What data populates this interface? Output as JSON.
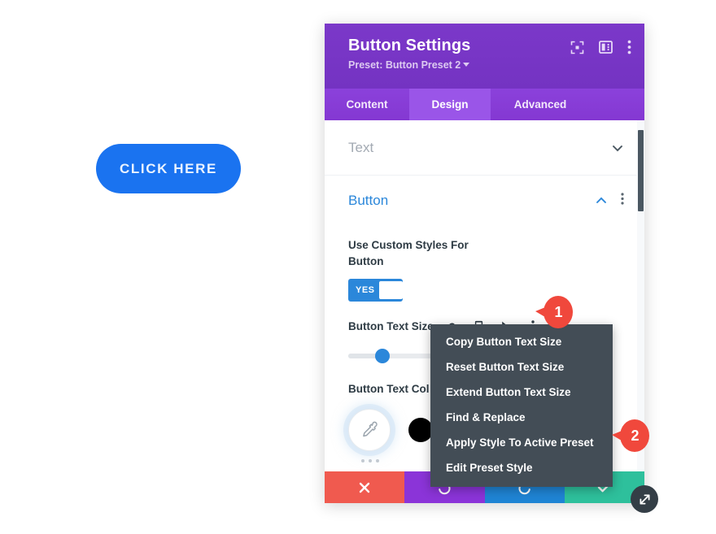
{
  "canvas": {
    "preview_button_label": "CLICK HERE"
  },
  "modal": {
    "title": "Button Settings",
    "preset_label": "Preset: Button Preset 2",
    "header_icons": [
      {
        "name": "fullscreen-icon",
        "label": "Fullscreen"
      },
      {
        "name": "layout-icon",
        "label": "Change Layout"
      },
      {
        "name": "more-vertical-icon",
        "label": "More Options"
      }
    ],
    "tabs": [
      {
        "label": "Content",
        "active": false
      },
      {
        "label": "Design",
        "active": true
      },
      {
        "label": "Advanced",
        "active": false
      }
    ],
    "sections": [
      {
        "label": "Text",
        "open": false
      },
      {
        "label": "Button",
        "open": true
      }
    ],
    "fields": {
      "custom_styles": {
        "label": "Use Custom Styles For Button",
        "toggle_value": "YES"
      },
      "text_size": {
        "label": "Button Text Size",
        "icons": [
          {
            "name": "help-icon",
            "glyph": "?"
          },
          {
            "name": "responsive-mobile-icon"
          },
          {
            "name": "hover-cursor-icon"
          },
          {
            "name": "more-vertical-icon"
          }
        ]
      },
      "text_color": {
        "label": "Button Text Col",
        "swatches": [
          "#000000",
          "#ffffff"
        ]
      }
    },
    "footer_buttons": [
      {
        "name": "cancel-button",
        "icon": "close-icon",
        "color": "#f05a4f"
      },
      {
        "name": "undo-button",
        "icon": "undo-icon",
        "color": "#8b34d8"
      },
      {
        "name": "redo-button",
        "icon": "redo-icon",
        "color": "#1f84d4"
      },
      {
        "name": "save-button",
        "icon": "check-icon",
        "color": "#2ec09c"
      }
    ]
  },
  "context_menu": {
    "items": [
      "Copy Button Text Size",
      "Reset Button Text Size",
      "Extend Button Text Size",
      "Find & Replace",
      "Apply Style To Active Preset",
      "Edit Preset Style"
    ]
  },
  "annotations": [
    {
      "number": "1"
    },
    {
      "number": "2"
    }
  ]
}
